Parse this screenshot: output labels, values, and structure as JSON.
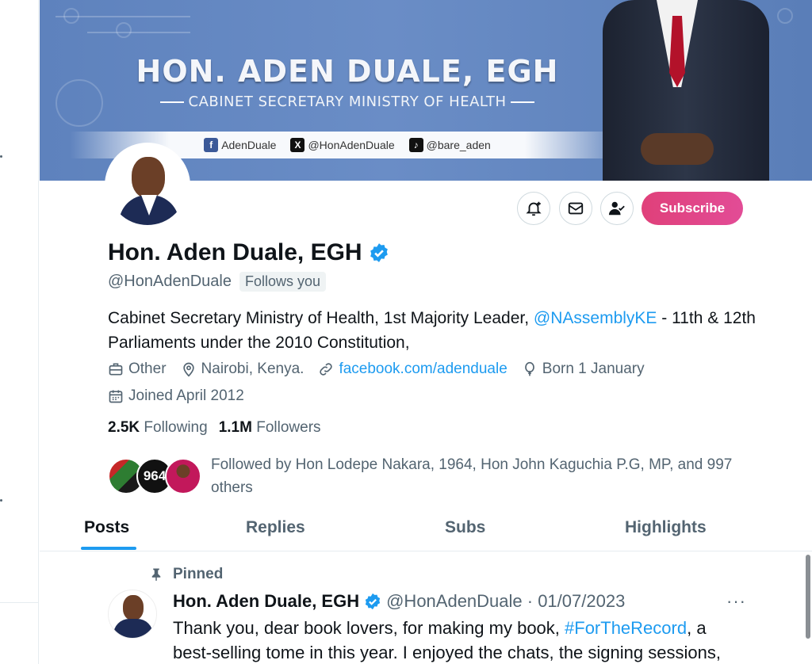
{
  "banner": {
    "title": "HON. ADEN DUALE, EGH",
    "subtitle": "CABINET SECRETARY MINISTRY OF HEALTH",
    "socials": [
      {
        "icon": "facebook-icon",
        "label": "AdenDuale"
      },
      {
        "icon": "x-icon",
        "label": "@HonAdenDuale"
      },
      {
        "icon": "tiktok-icon",
        "label": "@bare_aden"
      }
    ]
  },
  "actions": {
    "notify_icon": "bell-plus-icon",
    "message_icon": "envelope-icon",
    "follow_icon": "person-check-icon",
    "subscribe_label": "Subscribe"
  },
  "profile": {
    "name": "Hon. Aden Duale, EGH",
    "handle": "@HonAdenDuale",
    "follows_you": "Follows you",
    "bio_pre": "Cabinet Secretary Ministry of Health, 1st Majority Leader, ",
    "bio_mention": "@NAssemblyKE",
    "bio_post": " - 11th & 12th Parliaments under the 2010 Constitution,",
    "category": "Other",
    "location": "Nairobi, Kenya.",
    "website": "facebook.com/adenduale",
    "born": "Born 1 January",
    "joined": "Joined April 2012",
    "following_count": "2.5K",
    "following_label": "Following",
    "followers_count": "1.1M",
    "followers_label": "Followers",
    "followed_by": "Followed by Hon Lodepe Nakara, 1964, Hon John Kaguchia P.G, MP, and 997 others",
    "followed_avatar_badge": "964"
  },
  "tabs": [
    {
      "label": "Posts"
    },
    {
      "label": "Replies"
    },
    {
      "label": "Subs"
    },
    {
      "label": "Highlights"
    }
  ],
  "post": {
    "pinned_label": "Pinned",
    "author": "Hon. Aden Duale, EGH",
    "handle_date": "@HonAdenDuale · 01/07/2023",
    "more": "···",
    "text_pre": "Thank you, dear book lovers, for making my book, ",
    "hashtag": "#ForTheRecord",
    "text_post": ", a best-selling tome in this year. I enjoyed the chats, the signing sessions,"
  },
  "colors": {
    "accent": "#1d9bf0",
    "subscribe": "#e24c96",
    "banner": "#5e82bd"
  }
}
